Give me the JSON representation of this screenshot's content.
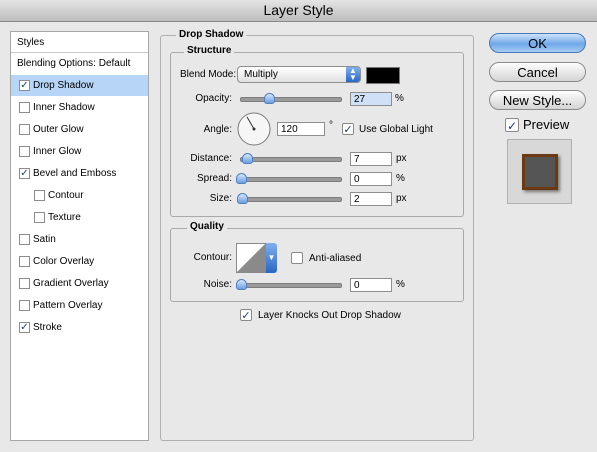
{
  "window": {
    "title": "Layer Style"
  },
  "left_panel": {
    "header": "Styles",
    "items": [
      {
        "label": "Blending Options: Default",
        "checkbox": false,
        "checked": false,
        "selected": false,
        "indent": 0
      },
      {
        "label": "Drop Shadow",
        "checkbox": true,
        "checked": true,
        "selected": true,
        "indent": 0
      },
      {
        "label": "Inner Shadow",
        "checkbox": true,
        "checked": false,
        "selected": false,
        "indent": 0
      },
      {
        "label": "Outer Glow",
        "checkbox": true,
        "checked": false,
        "selected": false,
        "indent": 0
      },
      {
        "label": "Inner Glow",
        "checkbox": true,
        "checked": false,
        "selected": false,
        "indent": 0
      },
      {
        "label": "Bevel and Emboss",
        "checkbox": true,
        "checked": true,
        "selected": false,
        "indent": 0
      },
      {
        "label": "Contour",
        "checkbox": true,
        "checked": false,
        "selected": false,
        "indent": 1
      },
      {
        "label": "Texture",
        "checkbox": true,
        "checked": false,
        "selected": false,
        "indent": 1
      },
      {
        "label": "Satin",
        "checkbox": true,
        "checked": false,
        "selected": false,
        "indent": 0
      },
      {
        "label": "Color Overlay",
        "checkbox": true,
        "checked": false,
        "selected": false,
        "indent": 0
      },
      {
        "label": "Gradient Overlay",
        "checkbox": true,
        "checked": false,
        "selected": false,
        "indent": 0
      },
      {
        "label": "Pattern Overlay",
        "checkbox": true,
        "checked": false,
        "selected": false,
        "indent": 0
      },
      {
        "label": "Stroke",
        "checkbox": true,
        "checked": true,
        "selected": false,
        "indent": 0
      }
    ]
  },
  "drop_shadow": {
    "title": "Drop Shadow",
    "structure": {
      "title": "Structure",
      "blend_mode_label": "Blend Mode:",
      "blend_mode_value": "Multiply",
      "shadow_color": "#000000",
      "opacity_label": "Opacity:",
      "opacity_value": "27",
      "opacity_unit": "%",
      "opacity_fraction": 0.27,
      "angle_label": "Angle:",
      "angle_value": "120",
      "angle_unit": "°",
      "global_light_label": "Use Global Light",
      "global_light_checked": true,
      "distance_label": "Distance:",
      "distance_value": "7",
      "distance_unit": "px",
      "distance_fraction": 0.03,
      "spread_label": "Spread:",
      "spread_value": "0",
      "spread_unit": "%",
      "spread_fraction": 0,
      "size_label": "Size:",
      "size_value": "2",
      "size_unit": "px",
      "size_fraction": 0.01
    },
    "quality": {
      "title": "Quality",
      "contour_label": "Contour:",
      "anti_aliased_label": "Anti-aliased",
      "anti_aliased_checked": false,
      "noise_label": "Noise:",
      "noise_value": "0",
      "noise_unit": "%",
      "noise_fraction": 0
    },
    "knockout_label": "Layer Knocks Out Drop Shadow",
    "knockout_checked": true
  },
  "buttons": {
    "ok": "OK",
    "cancel": "Cancel",
    "new_style": "New Style...",
    "preview_label": "Preview",
    "preview_checked": true
  },
  "colors": {
    "selection": "#b7d5f7",
    "accent": "#6fa8e8",
    "preview_swatch": "#555555",
    "preview_border": "#6b3a12"
  }
}
